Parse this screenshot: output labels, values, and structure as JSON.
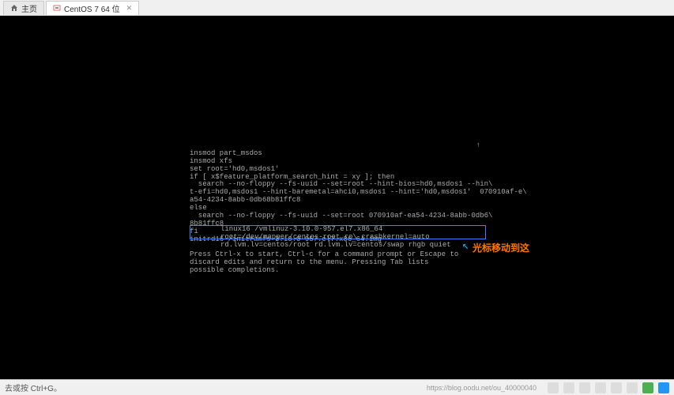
{
  "tabs": {
    "home": {
      "label": "主页"
    },
    "vm": {
      "label": "CentOS 7 64 位"
    }
  },
  "terminal": {
    "line1": "insmod part_msdos",
    "line2": "insmod xfs",
    "line3": "set root='hd0,msdos1'",
    "line4": "if [ x$feature_platform_search_hint = xy ]; then",
    "line5": "  search --no-floppy --fs-uuid --set=root --hint-bios=hd0,msdos1 --hin\\",
    "line6": "t-efi=hd0,msdos1 --hint-baremetal=ahci0,msdos1 --hint='hd0,msdos1'  070910af-e\\",
    "line7": "a54-4234-8abb-0db68b81ffc8",
    "line8": "else",
    "line9": "  search --no-floppy --fs-uuid --set=root 070910af-ea54-4234-8abb-0db6\\",
    "line10": "8b81ffc8",
    "line11": "fi",
    "hl1": "linux16 /vmlinuz-3.10.0-957.el7.x86_64 root=/dev/mapper/centos-root ro\\",
    "hl2": "crashkernel=auto rd.lvm.lv=centos/root rd.lvm.lv=centos/swap rhgb quiet",
    "line12": "initrd16 /initramfs-3.10.0-957.el7.x86_64.img",
    "help1": "Press Ctrl-x to start, Ctrl-c for a command prompt or Escape to",
    "help2": "discard edits and return to the menu. Pressing Tab lists",
    "help3": "possible completions.",
    "scroll_arrow": "↑"
  },
  "annotation": {
    "arrow": "↖",
    "text": "光标移动到这"
  },
  "status": {
    "hint": "去或按 Ctrl+G。",
    "watermark": "https://blog.oodu.net/ou_40000040"
  }
}
